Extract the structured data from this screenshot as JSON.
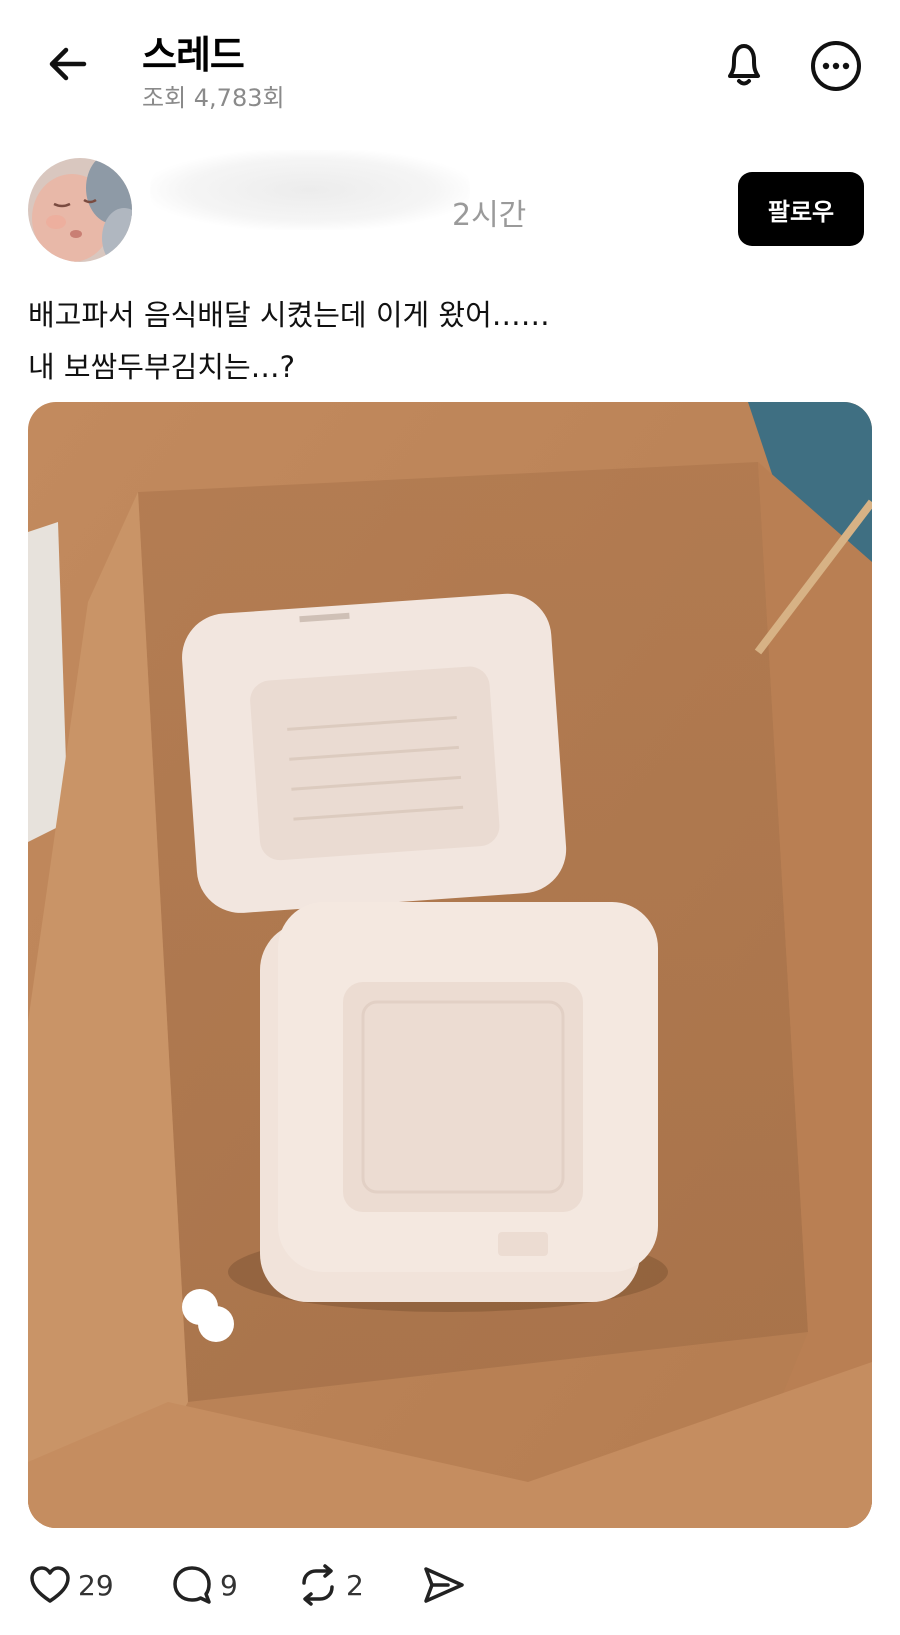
{
  "header": {
    "title": "스레드",
    "views": "조회 4,783회",
    "back_icon": "arrow-left-icon",
    "bell_icon": "bell-icon",
    "more_icon": "more-options-icon"
  },
  "post": {
    "author_time": "2시간",
    "follow_label": "팔로우",
    "caption_line1": "배고파서 음식배달 시켰는데 이게 왔어……",
    "caption_line2": "내 보쌈두부김치는…?"
  },
  "actions": {
    "likes": "29",
    "replies": "9",
    "reposts": "2"
  }
}
